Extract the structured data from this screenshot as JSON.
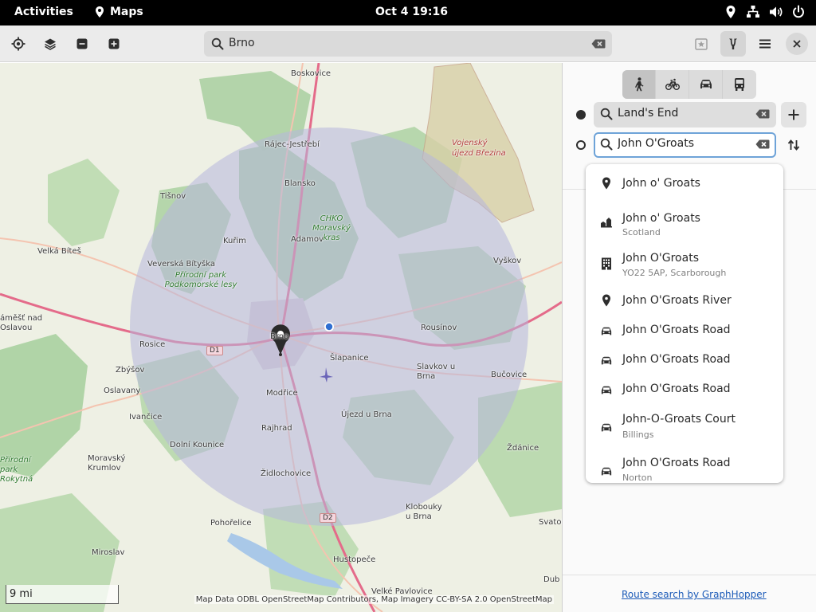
{
  "topbar": {
    "activities": "Activities",
    "app_name": "Maps",
    "clock": "Oct 4  19:16"
  },
  "header": {
    "search_value": "Brno",
    "buttons": [
      "locate-icon",
      "layers-icon",
      "zoom-out-icon",
      "zoom-in-icon",
      "favorites-icon",
      "route-icon",
      "menu-icon",
      "close-icon"
    ]
  },
  "map": {
    "places": {
      "boskovice": "Boskovice",
      "rajec": "Rájec-Jestřebí",
      "blansko": "Blansko",
      "tisnov": "Tišnov",
      "kurim": "Kuřim",
      "adamov": "Adamov",
      "velka_bites": "Velká Bíteš",
      "veverska": "Veverská Bítyška",
      "vyskov": "Vyškov",
      "rousinov": "Rousínov",
      "brno": "Brno",
      "slapanice": "Šlapanice",
      "rosice": "Rosice",
      "zbysov": "Zbýšov",
      "oslavany": "Oslavany",
      "ivancice": "Ivančice",
      "slavkov": "Slavkov u Brna",
      "bucovice": "Bučovice",
      "modrice": "Modřice",
      "ujezd": "Újezd u Brna",
      "rajhrad": "Rajhrad",
      "dolni_kounice": "Dolní Kounice",
      "zdanice": "Ždánice",
      "moravsky_krumlov": "Moravský Krumlov",
      "zidlochovice": "Židlochovice",
      "klobouky": "Klobouky u Brna",
      "pohorelice": "Pohořelice",
      "miroslav": "Miroslav",
      "hustopece": "Hustopeče",
      "velke_pavlovice": "Velké Pavlovice",
      "svatob": "Svatob",
      "dub": "Dub",
      "namest": "áměšť nad Oslavou",
      "vojensky": "Vojenský újezd Březina",
      "chko": "CHKO Moravský kras",
      "podkomorske": "Přírodní park Podkomorské lesy",
      "rokytna": "Přírodní park Rokytná",
      "d1": "D1",
      "d2": "D2"
    },
    "scale": "9 mi",
    "attribution": "Map Data ODBL OpenStreetMap Contributors, Map Imagery CC-BY-SA 2.0 OpenStreetMap",
    "colors": {
      "radius_fill": "#b7b6dc",
      "forest": "#a8cfa0",
      "motorway": "#e46b8a"
    }
  },
  "panel": {
    "modes": [
      "walk-icon",
      "bike-icon",
      "car-icon",
      "transit-icon"
    ],
    "active_mode": "walk",
    "from_value": "Land's End",
    "to_value": "John O'Groats",
    "link": "Route search by GraphHopper"
  },
  "suggestions": [
    {
      "icon": "pin-icon",
      "title": "John o' Groats",
      "subtitle": ""
    },
    {
      "icon": "village-icon",
      "title": "John o' Groats",
      "subtitle": "Scotland"
    },
    {
      "icon": "building-icon",
      "title": "John O'Groats",
      "subtitle": "YO22 5AP, Scarborough"
    },
    {
      "icon": "pin-icon",
      "title": "John O'Groats River",
      "subtitle": ""
    },
    {
      "icon": "car-icon",
      "title": "John O'Groats Road",
      "subtitle": ""
    },
    {
      "icon": "car-icon",
      "title": "John O'Groats Road",
      "subtitle": ""
    },
    {
      "icon": "car-icon",
      "title": "John O'Groats Road",
      "subtitle": ""
    },
    {
      "icon": "car-icon",
      "title": "John-O-Groats Court",
      "subtitle": "Billings"
    },
    {
      "icon": "car-icon",
      "title": "John O'Groats Road",
      "subtitle": "Norton"
    }
  ]
}
